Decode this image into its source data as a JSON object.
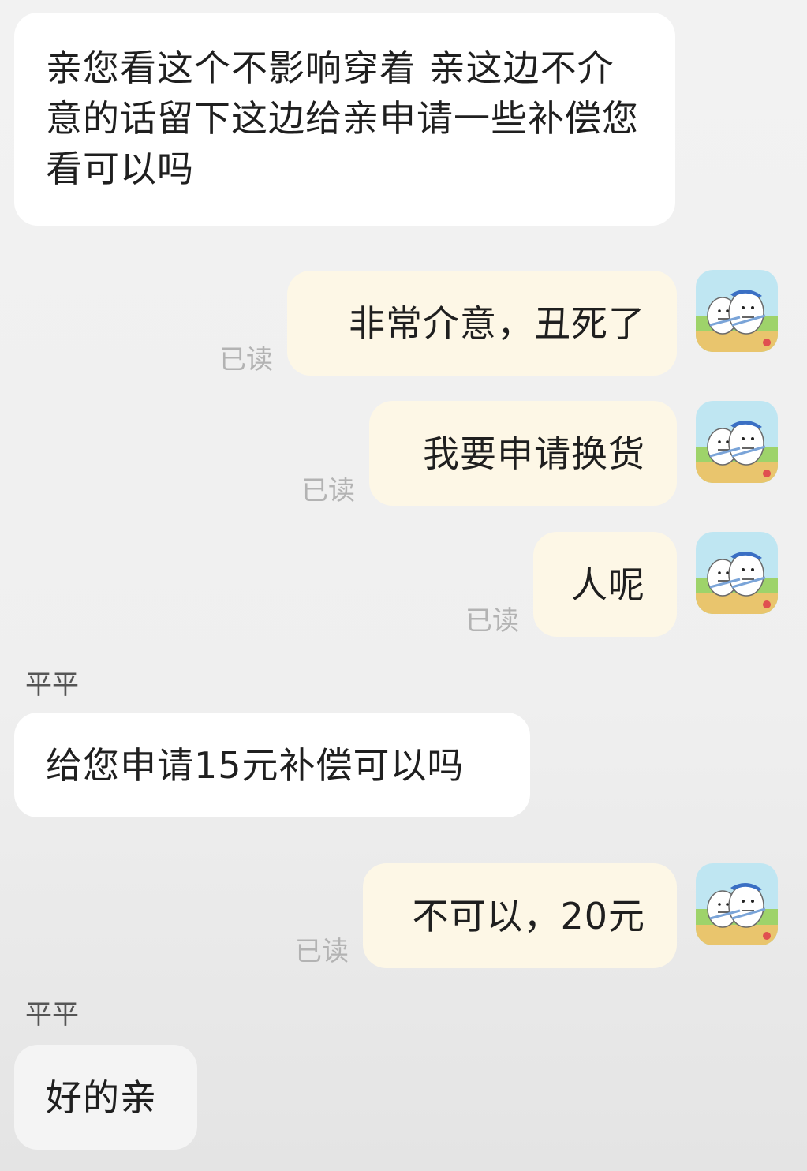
{
  "messages": [
    {
      "side": "incoming",
      "text": "亲您看这个不影响穿着 亲这边不介意的话留下这边给亲申请一些补偿您看可以吗"
    },
    {
      "side": "outgoing",
      "text": "非常介意，丑死了",
      "status": "已读"
    },
    {
      "side": "outgoing",
      "text": "我要申请换货",
      "status": "已读"
    },
    {
      "side": "outgoing",
      "text": "人呢",
      "status": "已读"
    },
    {
      "side": "incoming",
      "sender": "平平",
      "text": "给您申请15元补偿可以吗"
    },
    {
      "side": "outgoing",
      "text": "不可以，20元",
      "status": "已读"
    },
    {
      "side": "incoming",
      "sender": "平平",
      "text": "好的亲"
    }
  ],
  "avatar_icon": "cartoon-egg-characters-avatar",
  "colors": {
    "background": "#efefef",
    "incoming_bubble": "#ffffff",
    "outgoing_bubble": "#fdf7e6",
    "read_status": "#b3b3b3"
  }
}
